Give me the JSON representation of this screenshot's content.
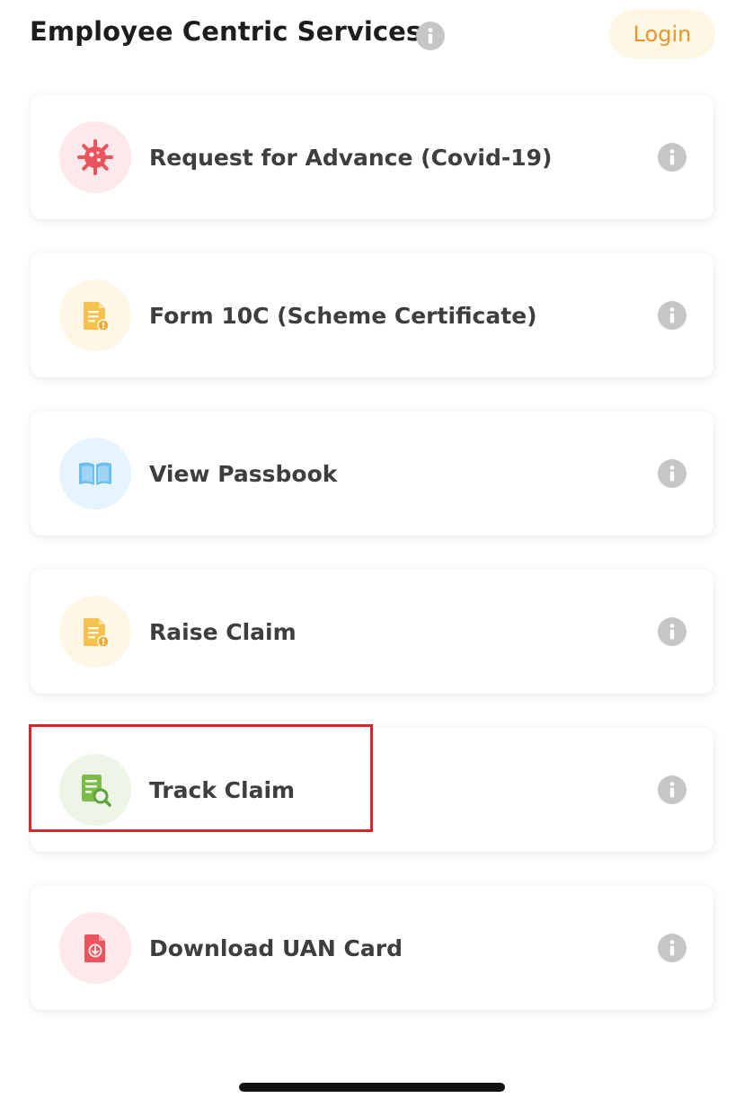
{
  "header": {
    "title": "Employee Centric Services",
    "info_icon": "info-icon",
    "login_label": "Login"
  },
  "colors": {
    "accent_orange": "#e8962d",
    "login_bg": "#fff6e3",
    "highlight_red": "#d6262c",
    "info_grey": "#c6c6c6"
  },
  "services": [
    {
      "label": "Request for Advance (Covid-19)",
      "icon": "virus-icon",
      "icon_color": "#e9545e",
      "icon_bg": "#fde9ea"
    },
    {
      "label": "Form 10C (Scheme Certificate)",
      "icon": "document-alert-icon",
      "icon_color": "#f5c24f",
      "icon_bg": "#fff7e5"
    },
    {
      "label": "View Passbook",
      "icon": "open-book-icon",
      "icon_color": "#6cbdf0",
      "icon_bg": "#e6f4fd"
    },
    {
      "label": "Raise Claim",
      "icon": "document-alert-icon",
      "icon_color": "#f5c24f",
      "icon_bg": "#fff7e5"
    },
    {
      "label": "Track Claim",
      "icon": "document-search-icon",
      "icon_color": "#7dbb4a",
      "icon_bg": "#edf5e7",
      "highlighted": true
    },
    {
      "label": "Download UAN Card",
      "icon": "file-download-icon",
      "icon_color": "#e9545e",
      "icon_bg": "#fde9ea"
    }
  ]
}
